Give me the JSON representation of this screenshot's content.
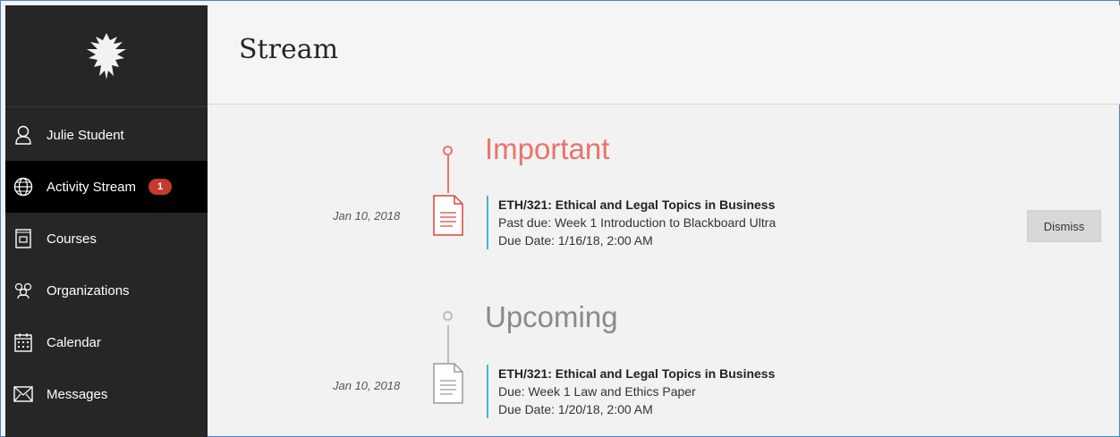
{
  "header": {
    "title": "Stream"
  },
  "sidebar": {
    "items": [
      {
        "label": "Julie Student",
        "icon": "user-icon"
      },
      {
        "label": "Activity Stream",
        "icon": "globe-icon",
        "badge": "1",
        "active": true
      },
      {
        "label": "Courses",
        "icon": "courses-icon"
      },
      {
        "label": "Organizations",
        "icon": "organizations-icon"
      },
      {
        "label": "Calendar",
        "icon": "calendar-icon"
      },
      {
        "label": "Messages",
        "icon": "envelope-icon"
      }
    ]
  },
  "stream": {
    "important": {
      "heading": "Important",
      "color": "#e8746b",
      "entry": {
        "date": "Jan 10, 2018",
        "title": "ETH/321: Ethical and Legal Topics in Business",
        "line1": "Past due: Week 1 Introduction to Blackboard Ultra",
        "line2": "Due Date: 1/16/18, 2:00 AM",
        "dismiss": "Dismiss"
      }
    },
    "upcoming": {
      "heading": "Upcoming",
      "color": "#8a8a8a",
      "entry": {
        "date": "Jan 10, 2018",
        "title": "ETH/321: Ethical and Legal Topics in Business",
        "line1": "Due: Week 1 Law and Ethics Paper",
        "line2": "Due Date: 1/20/18, 2:00 AM"
      }
    }
  }
}
